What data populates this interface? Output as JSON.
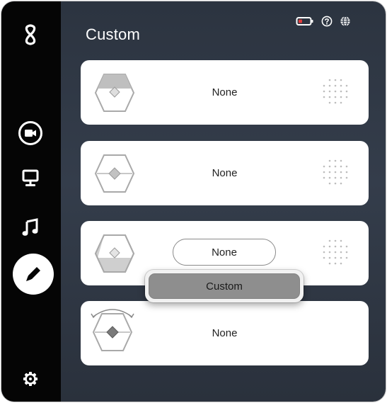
{
  "app": {
    "page_title": "Custom"
  },
  "sidebar": {
    "items": [
      {
        "name": "logo",
        "icon": "infinity-logo-icon"
      },
      {
        "name": "video",
        "icon": "video-camera-icon"
      },
      {
        "name": "display",
        "icon": "monitor-icon"
      },
      {
        "name": "audio",
        "icon": "music-note-icon"
      },
      {
        "name": "custom",
        "icon": "pencil-icon",
        "active": true
      },
      {
        "name": "settings",
        "icon": "gear-icon"
      }
    ]
  },
  "header_icons": {
    "battery": "battery-low-icon",
    "help": "help-icon",
    "language": "globe-icon",
    "battery_color": "#e23b3b"
  },
  "buttons": [
    {
      "label": "None",
      "icon": "hex-button-top-icon"
    },
    {
      "label": "None",
      "icon": "hex-button-middle-icon"
    },
    {
      "label": "None",
      "icon": "hex-button-left-icon",
      "dropdown_open": true
    },
    {
      "label": "None",
      "icon": "hex-button-rotate-icon"
    }
  ],
  "dropdown": {
    "options": [
      "Custom"
    ]
  },
  "colors": {
    "sidebar": "#050505",
    "panel": "#313a47",
    "card": "#ffffff",
    "highlight": "#8e8e8e"
  }
}
